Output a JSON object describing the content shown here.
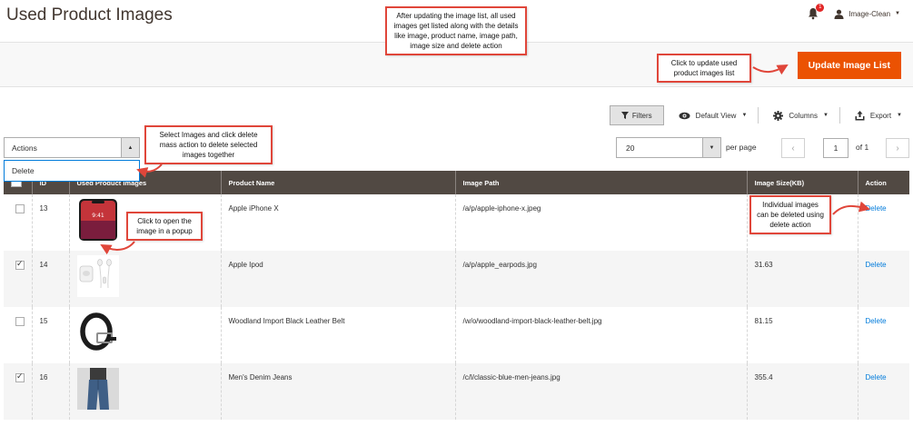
{
  "page": {
    "title": "Used Product Images"
  },
  "header": {
    "notifications_count": "1",
    "user_name": "Image-Clean"
  },
  "action_bar": {
    "update_button": "Update Image List"
  },
  "toolbar": {
    "filters": "Filters",
    "default_view": "Default View",
    "columns": "Columns",
    "export": "Export"
  },
  "mass_actions": {
    "label": "Actions",
    "options": [
      "Delete"
    ]
  },
  "pagination": {
    "per_page_value": "20",
    "per_page_label": "per page",
    "current_page": "1",
    "total": "of 1"
  },
  "columns": [
    "ID",
    "Used Product Images",
    "Product Name",
    "Image Path",
    "Image Size(KB)",
    "Action"
  ],
  "rows": [
    {
      "id": "13",
      "checked": false,
      "product_name": "Apple iPhone X",
      "image_path": "/a/p/apple-iphone-x.jpeg",
      "size": "",
      "action": "Delete",
      "thumb": "phone"
    },
    {
      "id": "14",
      "checked": true,
      "product_name": "Apple Ipod",
      "image_path": "/a/p/apple_earpods.jpg",
      "size": "31.63",
      "action": "Delete",
      "thumb": "earpods"
    },
    {
      "id": "15",
      "checked": false,
      "product_name": "Woodland Import Black Leather Belt",
      "image_path": "/w/o/woodland-import-black-leather-belt.jpg",
      "size": "81.15",
      "action": "Delete",
      "thumb": "belt"
    },
    {
      "id": "16",
      "checked": true,
      "product_name": "Men's Denim Jeans",
      "image_path": "/c/l/classic-blue-men-jeans.jpg",
      "size": "355.4",
      "action": "Delete",
      "thumb": "jeans"
    }
  ],
  "annotations": {
    "top": "After updating the image list, all used images get listed along with the details like image, product name, image path, image size and delete action",
    "update": "Click to update used product images list",
    "mass": "Select Images and click delete mass action to delete selected images together",
    "popup": "Click to open the image in a popup",
    "delete": "Individual images can be deleted using delete action"
  },
  "thumb_time": "9:41",
  "colors": {
    "accent": "#eb5202",
    "header_bg": "#514943",
    "link": "#007bdb",
    "annotation_border": "#e0463a"
  }
}
